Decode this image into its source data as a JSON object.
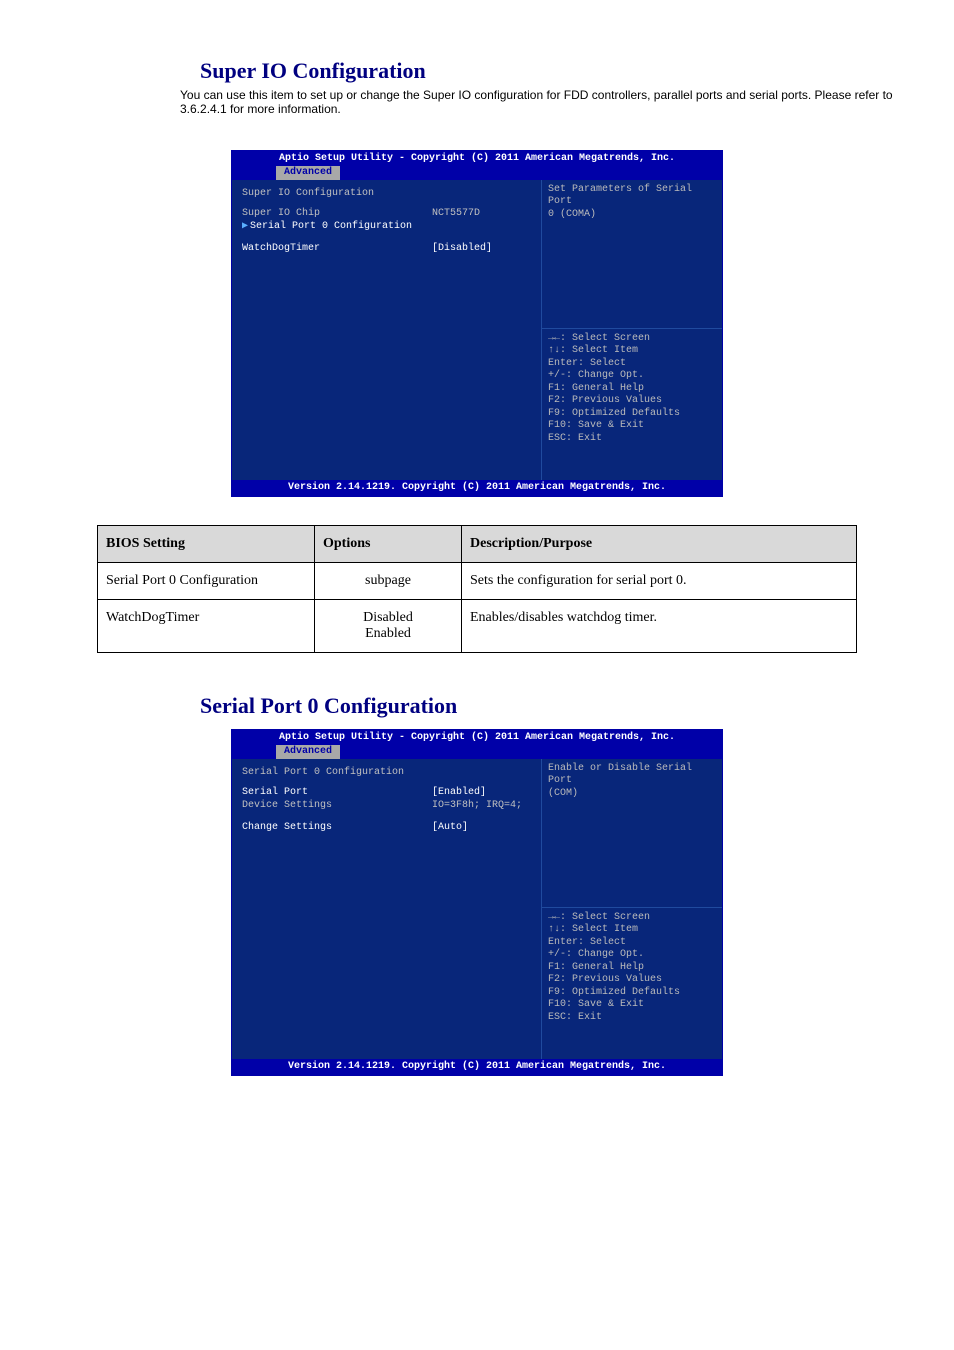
{
  "section1": {
    "heading": "Super IO Configuration",
    "caption": "You can use this item to set up or change the Super IO configuration for FDD controllers, parallel ports and serial ports. Please refer to 3.6.2.4.1 for more information."
  },
  "bios1": {
    "title": "Aptio Setup Utility - Copyright (C) 2011 American Megatrends, Inc.",
    "tab": "Advanced",
    "headerRow": "Super IO Configuration",
    "rows": [
      {
        "label": "Super IO Chip",
        "value": "NCT5577D",
        "cls": "cgray"
      },
      {
        "label": "Serial Port 0 Configuration",
        "value": "",
        "cls": "cwhite",
        "arrow": true
      },
      {
        "label": "",
        "value": ""
      },
      {
        "label": "WatchDogTimer",
        "value": "[Disabled]",
        "cls": "cwhite"
      }
    ],
    "descTop": "Set Parameters of Serial Port",
    "descBottom": "0  (COMA)",
    "hints": [
      "→←: Select Screen",
      "↑↓: Select Item",
      "Enter: Select",
      "+/-: Change Opt.",
      "F1: General Help",
      "F2: Previous Values",
      "F9: Optimized Defaults",
      "F10: Save & Exit",
      "ESC: Exit"
    ],
    "footer": "Version 2.14.1219. Copyright (C) 2011 American Megatrends, Inc."
  },
  "table": {
    "headers": [
      "BIOS Setting",
      "Options",
      "Description/Purpose"
    ],
    "rows": [
      [
        "Serial Port 0 Configuration",
        "subpage",
        "Sets the configuration for serial port 0."
      ],
      [
        "WatchDogTimer",
        "Disabled\nEnabled",
        "Enables/disables watchdog timer."
      ]
    ]
  },
  "section2": {
    "heading": "Serial Port 0 Configuration"
  },
  "bios2": {
    "title": "Aptio Setup Utility - Copyright (C) 2011 American Megatrends, Inc.",
    "tab": "Advanced",
    "headerRow": "Serial Port 0 Configuration",
    "rows": [
      {
        "label": "Serial Port",
        "value": "[Enabled]",
        "cls": "cwhite"
      },
      {
        "label": "Device Settings",
        "value": "IO=3F8h; IRQ=4;",
        "cls": "cgray"
      },
      {
        "label": "",
        "value": ""
      },
      {
        "label": "Change Settings",
        "value": "[Auto]",
        "cls": "cwhite"
      }
    ],
    "descTop": "Enable or Disable Serial Port",
    "descBottom": "(COM)",
    "hints": [
      "→←: Select Screen",
      "↑↓: Select Item",
      "Enter: Select",
      "+/-: Change Opt.",
      "F1: General Help",
      "F2: Previous Values",
      "F9: Optimized Defaults",
      "F10: Save & Exit",
      "ESC: Exit"
    ],
    "footer": "Version 2.14.1219. Copyright (C) 2011 American Megatrends, Inc."
  }
}
